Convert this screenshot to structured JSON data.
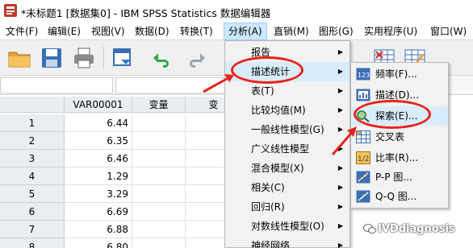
{
  "window": {
    "title": "*未标题1 [数据集0] - IBM SPSS Statistics 数据编辑器"
  },
  "menubar": {
    "items": [
      "文件(F)",
      "编辑(E)",
      "视图(V)",
      "数据(D)",
      "转换(T)",
      "分析(A)",
      "直销(M)",
      "图形(G)",
      "实用程序(U)",
      "窗口(W)"
    ],
    "active": "分析(A)"
  },
  "toolbar": {
    "icons": [
      "open-folder-icon",
      "save-icon",
      "print-icon",
      "dialog-recall-icon",
      "undo-icon",
      "redo-icon",
      "goto-case-icon",
      "split-file-icon"
    ]
  },
  "grid": {
    "col_headers": [
      "VAR00001",
      "变量",
      "变"
    ],
    "rows": [
      {
        "n": "1",
        "v": "6.44"
      },
      {
        "n": "2",
        "v": "6.35"
      },
      {
        "n": "3",
        "v": "6.46"
      },
      {
        "n": "4",
        "v": "1.29"
      },
      {
        "n": "5",
        "v": "3.29"
      },
      {
        "n": "6",
        "v": "6.69"
      },
      {
        "n": "7",
        "v": "6.88"
      },
      {
        "n": "8",
        "v": "6.80"
      }
    ]
  },
  "analyze_menu": {
    "items": [
      {
        "label": "报告",
        "submenu": true
      },
      {
        "label": "描述统计",
        "submenu": true,
        "highlighted": true
      },
      {
        "label": "表(T)",
        "submenu": true
      },
      {
        "label": "比较均值(M)",
        "submenu": true
      },
      {
        "label": "一般线性模型(G)",
        "submenu": true
      },
      {
        "label": "广义线性模型",
        "submenu": true
      },
      {
        "label": "混合模型(X)",
        "submenu": true
      },
      {
        "label": "相关(C)",
        "submenu": true
      },
      {
        "label": "回归(R)",
        "submenu": true
      },
      {
        "label": "对数线性模型(O)",
        "submenu": true
      },
      {
        "label": "神经网络",
        "submenu": true
      }
    ]
  },
  "descriptive_submenu": {
    "items": [
      {
        "label": "频率(F)...",
        "icon": "frequencies-icon"
      },
      {
        "label": "描述(D)...",
        "icon": "descriptives-icon"
      },
      {
        "label": "探索(E)...",
        "icon": "explore-icon",
        "highlighted": true
      },
      {
        "label": "交叉表",
        "icon": "crosstabs-icon"
      },
      {
        "label": "比率(R)...",
        "icon": "ratio-icon"
      },
      {
        "label": "P-P 图...",
        "icon": "pp-plot-icon"
      },
      {
        "label": "Q-Q 图...",
        "icon": "qq-plot-icon"
      }
    ]
  },
  "watermark": {
    "text": "IVDdiagnosis"
  },
  "colors": {
    "annotation_red": "#e8231a",
    "menu_highlight": "#d9ecfb",
    "header_bg": "#eaeef3"
  }
}
